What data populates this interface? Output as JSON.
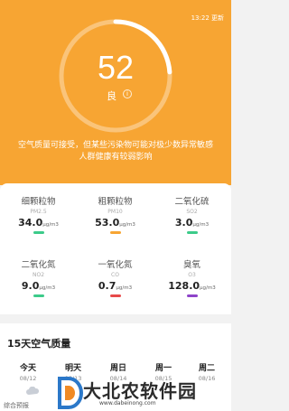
{
  "status_bar": {
    "update_time": "13:22 更新"
  },
  "aqi": {
    "value": "52",
    "level": "良",
    "info_glyph": "i"
  },
  "advice": "空气质量可接受，但某些污染物可能对极少数异常敏感人群健康有较弱影响",
  "colors": {
    "hero": "#f7a533",
    "good": "#3ccb8a",
    "moderate": "#f7a533",
    "co_bar": "#e74a4a",
    "o3_bar": "#8e44c9"
  },
  "pollutants": [
    {
      "name": "细颗粒物",
      "code": "PM2.5",
      "value": "34.0",
      "unit": "μg/m3"
    },
    {
      "name": "粗颗粒物",
      "code": "PM10",
      "value": "53.0",
      "unit": "μg/m3"
    },
    {
      "name": "二氧化硫",
      "code": "SO2",
      "value": "3.0",
      "unit": "μg/m3"
    },
    {
      "name": "二氧化氮",
      "code": "NO2",
      "value": "9.0",
      "unit": "μg/m3"
    },
    {
      "name": "一氧化氮",
      "code": "CO",
      "value": "0.7",
      "unit": "μg/m3"
    },
    {
      "name": "臭氧",
      "code": "O3",
      "value": "128.0",
      "unit": "μg/m3"
    }
  ],
  "forecast": {
    "title": "15天空气质量",
    "days": [
      {
        "name": "今天",
        "date": "08/12"
      },
      {
        "name": "明天",
        "date": "08/13"
      },
      {
        "name": "周日",
        "date": "08/14"
      },
      {
        "name": "周一",
        "date": "08/15"
      },
      {
        "name": "周二",
        "date": "08/16"
      }
    ],
    "sub_label": "综合预报"
  },
  "watermark": {
    "text": "大北农软件园",
    "url": "www.dabeinong.com"
  }
}
